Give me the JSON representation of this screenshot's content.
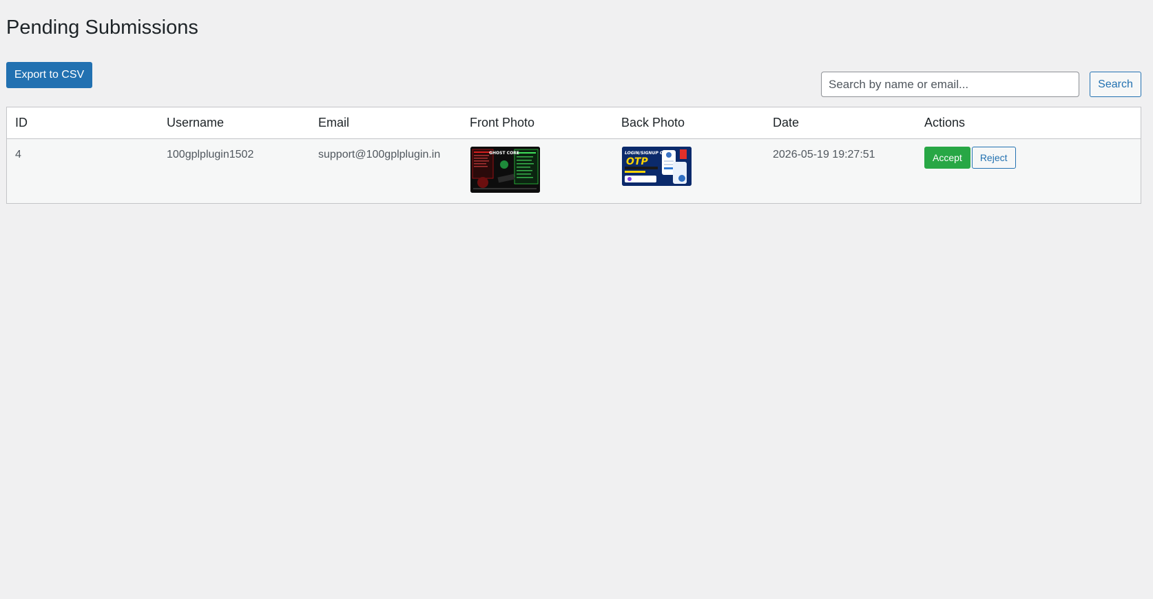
{
  "page": {
    "title": "Pending Submissions"
  },
  "toolbar": {
    "export_label": "Export to CSV",
    "search_placeholder": "Search by name or email...",
    "search_value": "",
    "search_label": "Search"
  },
  "table": {
    "columns": [
      "ID",
      "Username",
      "Email",
      "Front Photo",
      "Back Photo",
      "Date",
      "Actions"
    ],
    "rows": [
      {
        "id": "4",
        "username": "100gplplugin1502",
        "email": "support@100gplplugin.in",
        "front_photo_text": "GHOST CORE",
        "back_photo_text": "LOGIN/SIGNUP OTP",
        "date": "2026-05-19 19:27:51",
        "accept_label": "Accept",
        "reject_label": "Reject"
      }
    ]
  },
  "colors": {
    "primary": "#2271b1",
    "accept": "#28a745",
    "background": "#f0f0f1"
  }
}
